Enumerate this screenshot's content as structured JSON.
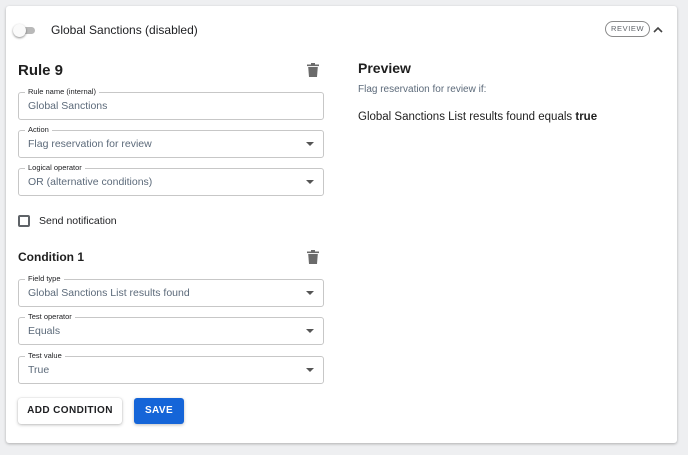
{
  "header": {
    "toggle_state": "off",
    "title": "Global Sanctions (disabled)",
    "badge": "REVIEW"
  },
  "rule": {
    "heading": "Rule 9",
    "fields": {
      "rule_name": {
        "label": "Rule name (internal)",
        "value": "Global Sanctions"
      },
      "action": {
        "label": "Action",
        "value": "Flag reservation for review"
      },
      "logical_operator": {
        "label": "Logical operator",
        "value": "OR (alternative conditions)"
      }
    },
    "send_notification": {
      "label": "Send notification",
      "checked": false
    }
  },
  "condition": {
    "heading": "Condition 1",
    "fields": {
      "field_type": {
        "label": "Field type",
        "value": "Global Sanctions List results found"
      },
      "test_operator": {
        "label": "Test operator",
        "value": "Equals"
      },
      "test_value": {
        "label": "Test value",
        "value": "True"
      }
    }
  },
  "buttons": {
    "add_condition": "ADD CONDITION",
    "save": "SAVE"
  },
  "preview": {
    "title": "Preview",
    "subtitle": "Flag reservation for review if:",
    "statement": "Global Sanctions List results found equals",
    "statement_value": "true"
  },
  "colors": {
    "primary": "#1565d8",
    "field_text": "#5c6a7a",
    "background": "#eeeff1"
  },
  "icons": [
    "toggle-switch",
    "chevron-up-icon",
    "trash-icon",
    "dropdown-caret-icon",
    "checkbox-unchecked"
  ]
}
